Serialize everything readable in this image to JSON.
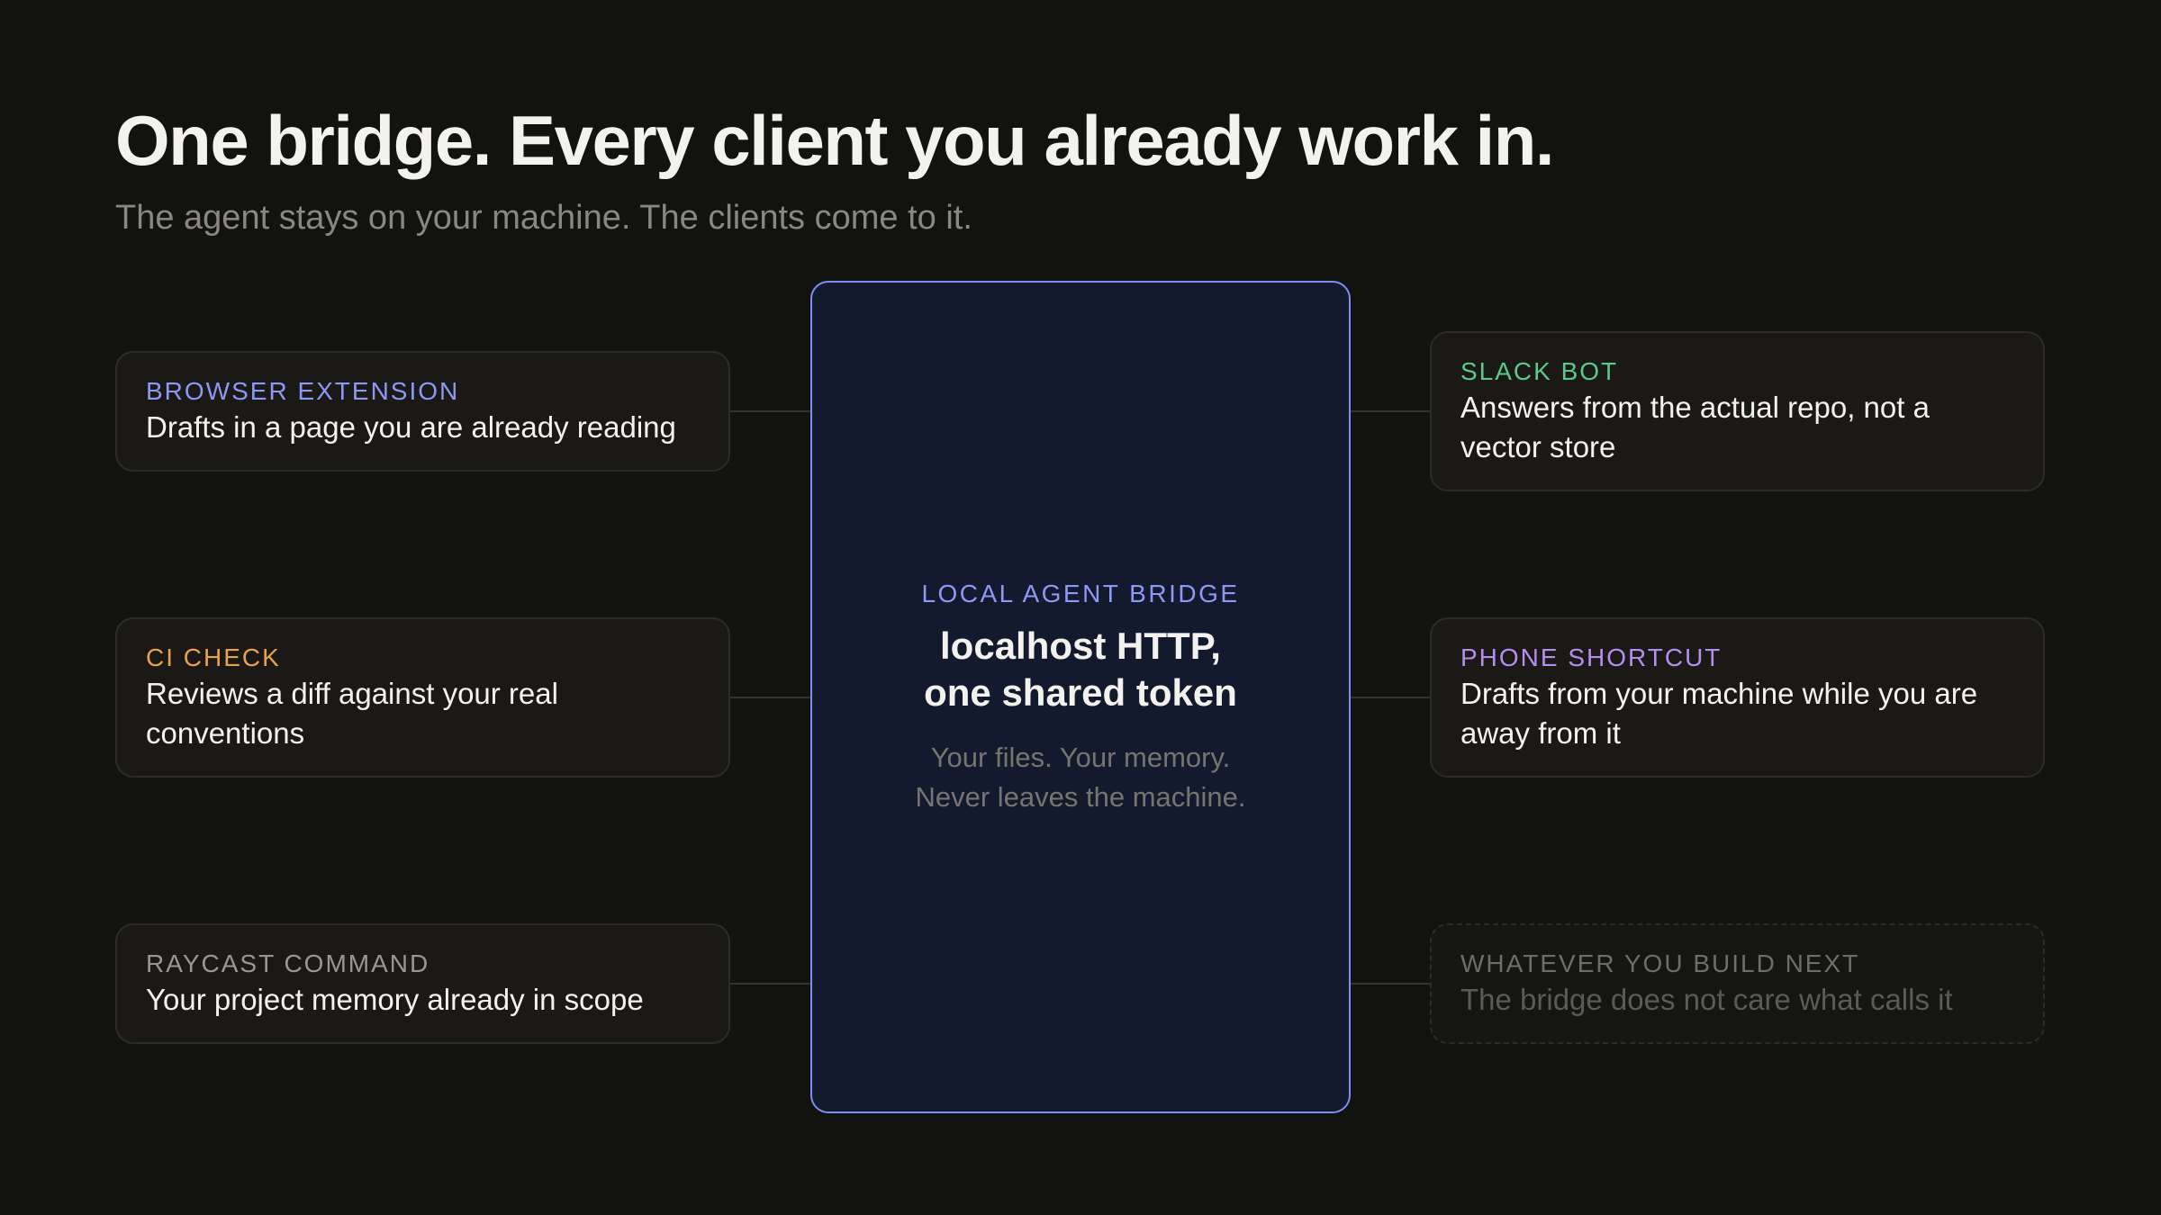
{
  "header": {
    "title": "One bridge. Every client you already work in.",
    "subtitle": "The agent stays on your machine. The clients come to it."
  },
  "hub": {
    "label": "LOCAL AGENT BRIDGE",
    "title_line1": "localhost HTTP,",
    "title_line2": "one shared token",
    "note_line1": "Your files. Your memory.",
    "note_line2": "Never leaves the machine.",
    "accent_color": "#7f8cf0",
    "background_color": "#141a2d"
  },
  "clients": {
    "left": [
      {
        "label": "BROWSER EXTENSION",
        "description": "Drafts in a page you are already reading",
        "label_color": "#8c98f5"
      },
      {
        "label": "CI CHECK",
        "description": "Reviews a diff against your real conventions",
        "label_color": "#e9a14b"
      },
      {
        "label": "RAYCAST COMMAND",
        "description": "Your project memory already in scope",
        "label_color": "#9a9792"
      }
    ],
    "right": [
      {
        "label": "SLACK BOT",
        "description": "Answers from the actual repo, not a vector store",
        "label_color": "#5cc88a"
      },
      {
        "label": "PHONE SHORTCUT",
        "description": "Drafts from your machine while you are away from it",
        "label_color": "#b58df0"
      },
      {
        "label": "WHATEVER YOU BUILD NEXT",
        "description": "The bridge does not care what calls it",
        "label_color": "#6f6d68"
      }
    ]
  }
}
